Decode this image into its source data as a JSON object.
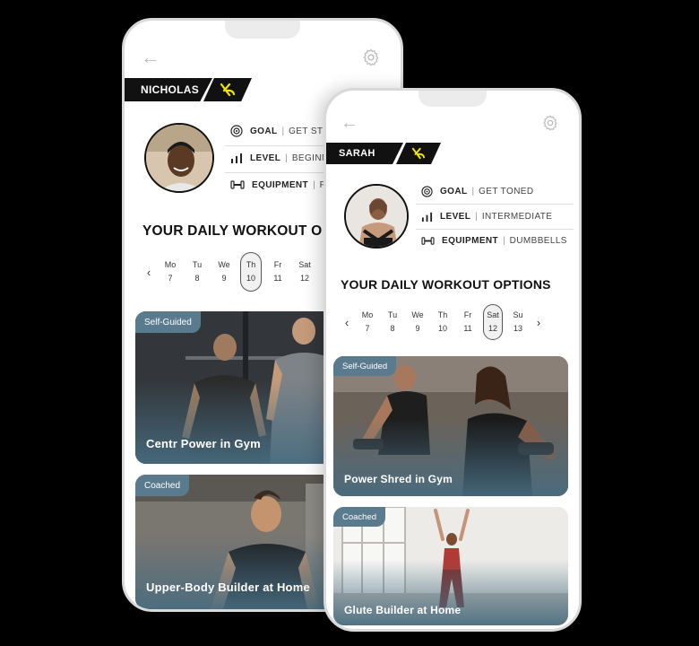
{
  "phones": [
    {
      "user_name": "NICHOLAS",
      "stats": [
        {
          "label": "GOAL",
          "value": "GET STRE"
        },
        {
          "label": "LEVEL",
          "value": "BEGINN"
        },
        {
          "label": "EQUIPMENT",
          "value": "F"
        }
      ],
      "heading": "YOUR DAILY WORKOUT O",
      "days": [
        {
          "dow": "Mo",
          "date": "7"
        },
        {
          "dow": "Tu",
          "date": "8"
        },
        {
          "dow": "We",
          "date": "9"
        },
        {
          "dow": "Th",
          "date": "10"
        },
        {
          "dow": "Fr",
          "date": "11"
        },
        {
          "dow": "Sat",
          "date": "12"
        }
      ],
      "selected_day": "Th",
      "cards": [
        {
          "badge": "Self-Guided",
          "title": "Centr Power in Gym"
        },
        {
          "badge": "Coached",
          "title": "Upper-Body Builder at Home"
        }
      ]
    },
    {
      "user_name": "SARAH",
      "stats": [
        {
          "label": "GOAL",
          "value": "GET TONED"
        },
        {
          "label": "LEVEL",
          "value": "INTERMEDIATE"
        },
        {
          "label": "EQUIPMENT",
          "value": "DUMBBELLS"
        }
      ],
      "heading": "YOUR DAILY WORKOUT OPTIONS",
      "days": [
        {
          "dow": "Mo",
          "date": "7"
        },
        {
          "dow": "Tu",
          "date": "8"
        },
        {
          "dow": "We",
          "date": "9"
        },
        {
          "dow": "Th",
          "date": "10"
        },
        {
          "dow": "Fr",
          "date": "11"
        },
        {
          "dow": "Sat",
          "date": "12"
        },
        {
          "dow": "Su",
          "date": "13"
        }
      ],
      "selected_day": "Sat",
      "cards": [
        {
          "badge": "Self-Guided",
          "title": "Power Shred in Gym"
        },
        {
          "badge": "Coached",
          "title": "Glute Builder at Home"
        }
      ]
    }
  ],
  "colors": {
    "badge": "#5a7b8e",
    "accent_logo": "#f2e600",
    "dark": "#111111"
  }
}
